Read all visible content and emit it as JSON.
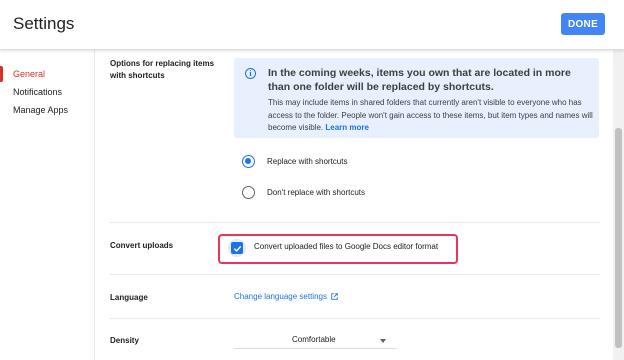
{
  "header": {
    "title": "Settings",
    "done_label": "DONE"
  },
  "sidebar": {
    "items": [
      {
        "label": "General",
        "active": true
      },
      {
        "label": "Notifications",
        "active": false
      },
      {
        "label": "Manage Apps",
        "active": false
      }
    ]
  },
  "shortcuts": {
    "label": "Options for replacing items with shortcuts",
    "info": {
      "icon": "info-icon",
      "heading": "In the coming weeks, items you own that are located in more than one folder will be replaced by shortcuts.",
      "body": "This may include items in shared folders that currently aren't visible to everyone who has access to the folder. People won't gain access to these items, but item types and names will become visible.",
      "link": "Learn more"
    },
    "options": [
      {
        "label": "Replace with shortcuts",
        "selected": true
      },
      {
        "label": "Don't replace with shortcuts",
        "selected": false
      }
    ]
  },
  "convert_uploads": {
    "label": "Convert uploads",
    "checkbox_label": "Convert uploaded files to Google Docs editor format",
    "checked": true
  },
  "language": {
    "label": "Language",
    "link": "Change language settings",
    "link_icon": "external-link-icon"
  },
  "density": {
    "label": "Density",
    "value": "Comfortable"
  },
  "colors": {
    "accent": "#1a73e8",
    "active_nav": "#d93025",
    "highlight": "#e8355a",
    "info_bg": "#e8f0fe"
  }
}
